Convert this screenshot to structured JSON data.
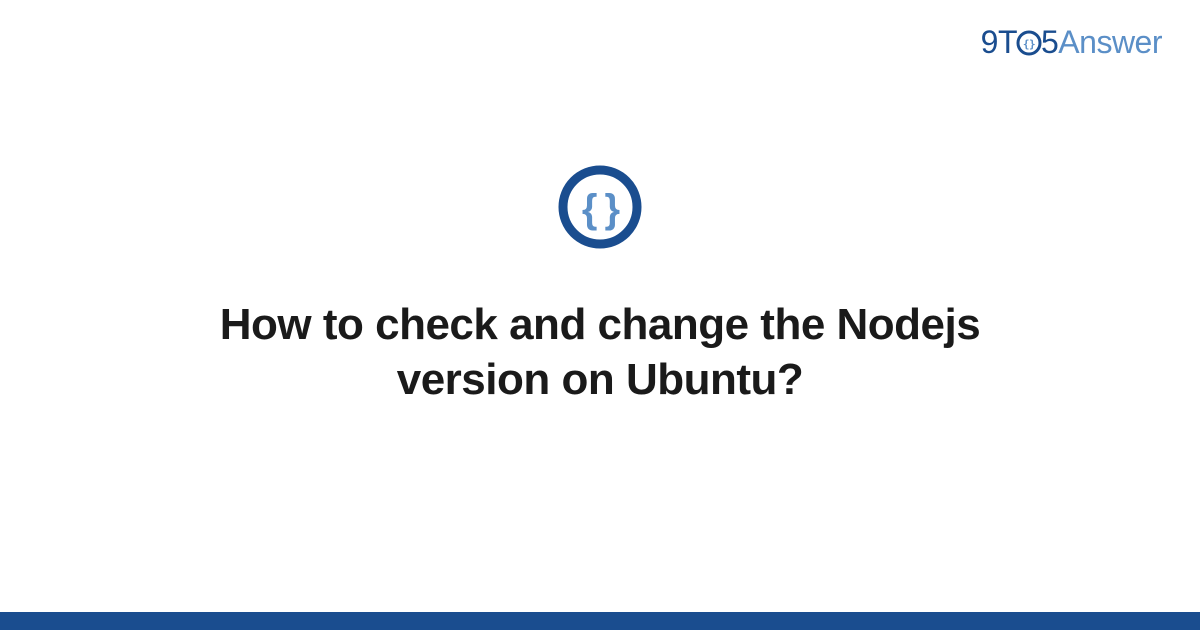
{
  "site": {
    "logo_prefix": "9T",
    "logo_middle_digit": "5",
    "logo_suffix": "Answer"
  },
  "icon": {
    "name": "curly-braces-icon",
    "ring_color": "#1a4d8f",
    "brace_color": "#5b8fc7"
  },
  "question": {
    "title": "How to check and change the Nodejs version on Ubuntu?"
  },
  "footer": {
    "bar_color": "#1a4d8f"
  }
}
